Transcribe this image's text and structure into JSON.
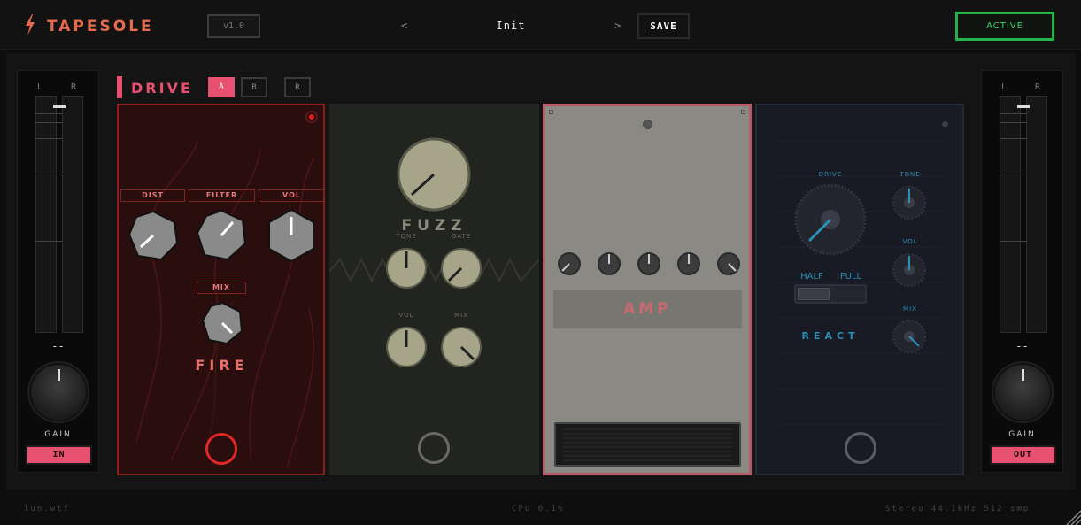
{
  "header": {
    "brand": "TAPESOLE",
    "version": "v1.0",
    "prev": "<",
    "next": ">",
    "preset": "Init",
    "save_label": "SAVE",
    "active_label": "ACTIVE"
  },
  "meters": {
    "input": {
      "l": "L",
      "r": "R",
      "readout": "--",
      "gain_label": "GAIN",
      "button": "IN"
    },
    "output": {
      "l": "L",
      "r": "R",
      "readout": "--",
      "gain_label": "GAIN",
      "button": "OUT"
    }
  },
  "section": {
    "title": "DRIVE",
    "slots": [
      "A",
      "B",
      "R"
    ],
    "active_slot": "A"
  },
  "pedals": {
    "fire": {
      "name": "FIRE",
      "labels": {
        "dist": "DIST",
        "filter": "FILTER",
        "vol": "VOL",
        "mix": "MIX"
      },
      "color": "#e8506f"
    },
    "fuzz": {
      "name": "FUZZ",
      "labels": {
        "tone": "TONE",
        "gate": "GATE",
        "vol": "VOL",
        "mix": "MIX"
      }
    },
    "amp": {
      "name": "AMP"
    },
    "react": {
      "name": "REACT",
      "labels": {
        "drive": "DRIVE",
        "tone": "TONE",
        "vol": "VOL",
        "mix": "MIX",
        "half": "HALF",
        "full": "FULL"
      },
      "accent": "#2a8fb4"
    }
  },
  "footer": {
    "site": "lun.wtf",
    "cpu": "CPU 0.1%",
    "status": "Stereo 44.1kHz 512 smp"
  },
  "colors": {
    "accent": "#e8506f",
    "active_green": "#26b04b",
    "brand": "#e66a4d"
  }
}
